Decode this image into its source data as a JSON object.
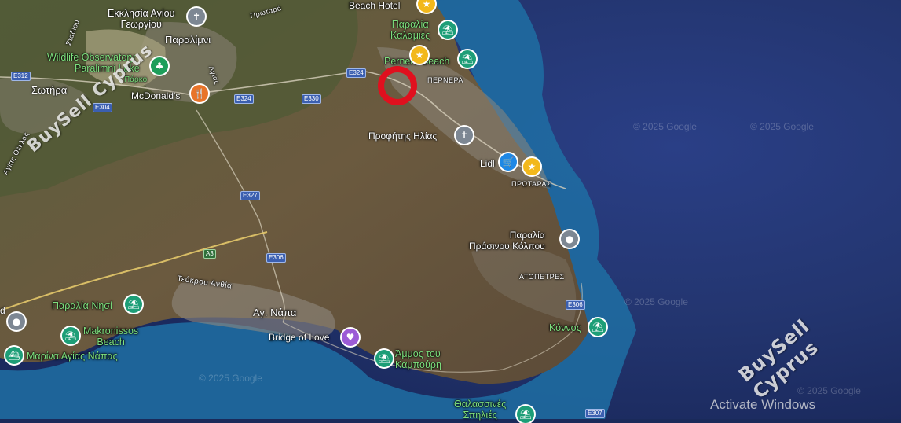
{
  "map": {
    "labels": {
      "ekklisia": "Εκκλησία Αγίου\nΓεωργίου",
      "paralimni": "Παραλίμνι",
      "wildlife": "Wildlife Observatory",
      "paralimni_lake": "Paralimni Lake",
      "parko": "Πάρκο",
      "sotira": "Σωτήρα",
      "mcdonalds": "McDonald's",
      "achnas": "Αγίας Θέκλας",
      "stadiou": "Σταδίου",
      "protara_rd": "Πρωταρά",
      "achias": "Αγίας",
      "beach_hotel": "Beach Hotel",
      "paralia_kalamies": "Παραλία\nΚαλαμιές",
      "pernera_beach": "Pernera Beach",
      "pernera": "ΠΕΡΝΕΡΑ",
      "profitis": "Προφήτης Ηλίας",
      "lidl": "Lidl",
      "protaras": "ΠΡΩΤΑΡΑΣ",
      "prasinou": "Παραλία\nΠράσινου Κόλπου",
      "atopetres": "ΑΤΟΠΕΤΡΕΣ",
      "teukrou": "Τεύκρου Ανθία",
      "agia_napa": "Αγ. Νάπα",
      "paralia_nissi": "Παραλία Νησί",
      "makronissos": "Makronissos\nBeach",
      "marina": "Μαρίνα Αγίας Νάπας",
      "bridge_of_love": "Bridge of Love",
      "ammos": "Άμμος του\nΚαμπούρη",
      "konnos": "Κόννος",
      "thalassines": "Θαλασσινές\nΣπηλιές",
      "partial_d": "d"
    },
    "roads": {
      "e312": "E312",
      "e304": "E304",
      "e324a": "E324",
      "e324b": "E324",
      "e330": "E330",
      "e327": "E327",
      "a3": "A3",
      "e306a": "E306",
      "e306b": "E306",
      "e307": "E307"
    },
    "copyright": "© 2025 Google",
    "watermark": "BuySell Cyprus",
    "activate_windows": "Activate Windows",
    "marker_color": "#e0101e"
  }
}
